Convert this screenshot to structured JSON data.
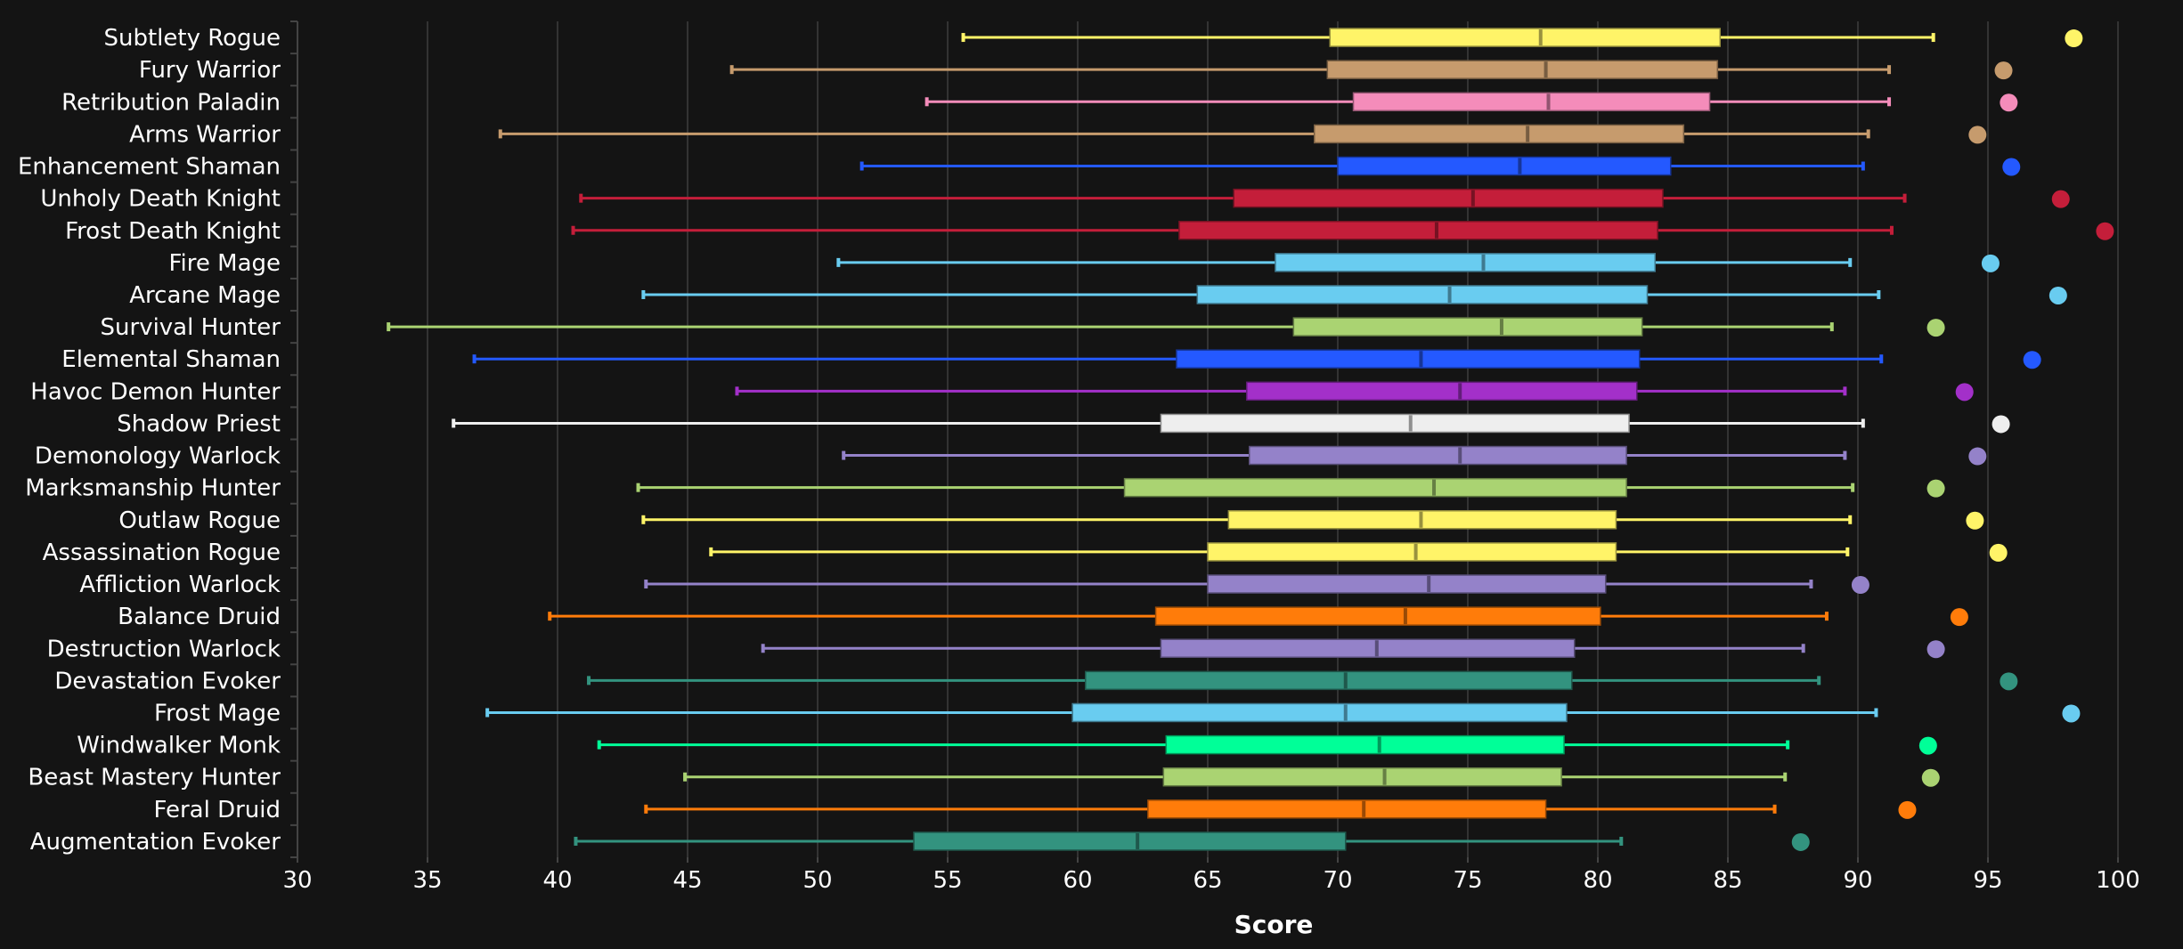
{
  "chart_data": {
    "type": "boxplot-horizontal",
    "title": "",
    "xlabel": "Score",
    "ylabel": "",
    "xlim": [
      30,
      100
    ],
    "xticks": [
      30,
      35,
      40,
      45,
      50,
      55,
      60,
      65,
      70,
      75,
      80,
      85,
      90,
      95,
      100
    ],
    "grid": "vertical",
    "legend": "none",
    "series": [
      {
        "name": "Subtlety Rogue",
        "color": "#FFF468",
        "min": 55.6,
        "q1": 69.7,
        "median": 77.8,
        "q3": 84.7,
        "max": 92.9,
        "outlier": 98.3
      },
      {
        "name": "Fury Warrior",
        "color": "#C69B6D",
        "min": 46.7,
        "q1": 69.6,
        "median": 78.0,
        "q3": 84.6,
        "max": 91.2,
        "outlier": 95.6
      },
      {
        "name": "Retribution Paladin",
        "color": "#F48CBA",
        "min": 54.2,
        "q1": 70.6,
        "median": 78.1,
        "q3": 84.3,
        "max": 91.2,
        "outlier": 95.8
      },
      {
        "name": "Arms Warrior",
        "color": "#C69B6D",
        "min": 37.8,
        "q1": 69.1,
        "median": 77.3,
        "q3": 83.3,
        "max": 90.4,
        "outlier": 94.6
      },
      {
        "name": "Enhancement Shaman",
        "color": "#2459FF",
        "min": 51.7,
        "q1": 70.0,
        "median": 77.0,
        "q3": 82.8,
        "max": 90.2,
        "outlier": 95.9
      },
      {
        "name": "Unholy Death Knight",
        "color": "#C41E3A",
        "min": 40.9,
        "q1": 66.0,
        "median": 75.2,
        "q3": 82.5,
        "max": 91.8,
        "outlier": 97.8
      },
      {
        "name": "Frost Death Knight",
        "color": "#C41E3A",
        "min": 40.6,
        "q1": 63.9,
        "median": 73.8,
        "q3": 82.3,
        "max": 91.3,
        "outlier": 99.5
      },
      {
        "name": "Fire Mage",
        "color": "#69CCF0",
        "min": 50.8,
        "q1": 67.6,
        "median": 75.6,
        "q3": 82.2,
        "max": 89.7,
        "outlier": 95.1
      },
      {
        "name": "Arcane Mage",
        "color": "#69CCF0",
        "min": 43.3,
        "q1": 64.6,
        "median": 74.3,
        "q3": 81.9,
        "max": 90.8,
        "outlier": 97.7
      },
      {
        "name": "Survival Hunter",
        "color": "#AAD372",
        "min": 33.5,
        "q1": 68.3,
        "median": 76.3,
        "q3": 81.7,
        "max": 89.0,
        "outlier": 93.0
      },
      {
        "name": "Elemental Shaman",
        "color": "#2459FF",
        "min": 36.8,
        "q1": 63.8,
        "median": 73.2,
        "q3": 81.6,
        "max": 90.9,
        "outlier": 96.7
      },
      {
        "name": "Havoc Demon Hunter",
        "color": "#A330C9",
        "min": 46.9,
        "q1": 66.5,
        "median": 74.7,
        "q3": 81.5,
        "max": 89.5,
        "outlier": 94.1
      },
      {
        "name": "Shadow Priest",
        "color": "#EEEEEE",
        "min": 36.0,
        "q1": 63.2,
        "median": 72.8,
        "q3": 81.2,
        "max": 90.2,
        "outlier": 95.5
      },
      {
        "name": "Demonology Warlock",
        "color": "#9482C9",
        "min": 51.0,
        "q1": 66.6,
        "median": 74.7,
        "q3": 81.1,
        "max": 89.5,
        "outlier": 94.6
      },
      {
        "name": "Marksmanship Hunter",
        "color": "#AAD372",
        "min": 43.1,
        "q1": 61.8,
        "median": 73.7,
        "q3": 81.1,
        "max": 89.8,
        "outlier": 93.0
      },
      {
        "name": "Outlaw Rogue",
        "color": "#FFF468",
        "min": 43.3,
        "q1": 65.8,
        "median": 73.2,
        "q3": 80.7,
        "max": 89.7,
        "outlier": 94.5
      },
      {
        "name": "Assassination Rogue",
        "color": "#FFF468",
        "min": 45.9,
        "q1": 65.0,
        "median": 73.0,
        "q3": 80.7,
        "max": 89.6,
        "outlier": 95.4
      },
      {
        "name": "Affliction Warlock",
        "color": "#9482C9",
        "min": 43.4,
        "q1": 65.0,
        "median": 73.5,
        "q3": 80.3,
        "max": 88.2,
        "outlier": 90.1
      },
      {
        "name": "Balance Druid",
        "color": "#FF7C0A",
        "min": 39.7,
        "q1": 63.0,
        "median": 72.6,
        "q3": 80.1,
        "max": 88.8,
        "outlier": 93.9
      },
      {
        "name": "Destruction Warlock",
        "color": "#9482C9",
        "min": 47.9,
        "q1": 63.2,
        "median": 71.5,
        "q3": 79.1,
        "max": 87.9,
        "outlier": 93.0
      },
      {
        "name": "Devastation Evoker",
        "color": "#33937F",
        "min": 41.2,
        "q1": 60.3,
        "median": 70.3,
        "q3": 79.0,
        "max": 88.5,
        "outlier": 95.8
      },
      {
        "name": "Frost Mage",
        "color": "#69CCF0",
        "min": 37.3,
        "q1": 59.8,
        "median": 70.3,
        "q3": 78.8,
        "max": 90.7,
        "outlier": 98.2
      },
      {
        "name": "Windwalker Monk",
        "color": "#00FF98",
        "min": 41.6,
        "q1": 63.4,
        "median": 71.6,
        "q3": 78.7,
        "max": 87.3,
        "outlier": 92.7
      },
      {
        "name": "Beast Mastery Hunter",
        "color": "#AAD372",
        "min": 44.9,
        "q1": 63.3,
        "median": 71.8,
        "q3": 78.6,
        "max": 87.2,
        "outlier": 92.8
      },
      {
        "name": "Feral Druid",
        "color": "#FF7C0A",
        "min": 43.4,
        "q1": 62.7,
        "median": 71.0,
        "q3": 78.0,
        "max": 86.8,
        "outlier": 91.9
      },
      {
        "name": "Augmentation Evoker",
        "color": "#33937F",
        "min": 40.7,
        "q1": 53.7,
        "median": 62.3,
        "q3": 70.3,
        "max": 80.9,
        "outlier": 87.8
      }
    ]
  },
  "colors": {
    "background": "#141414",
    "grid": "#333333",
    "axis": "#444444",
    "text": "#ffffff"
  }
}
